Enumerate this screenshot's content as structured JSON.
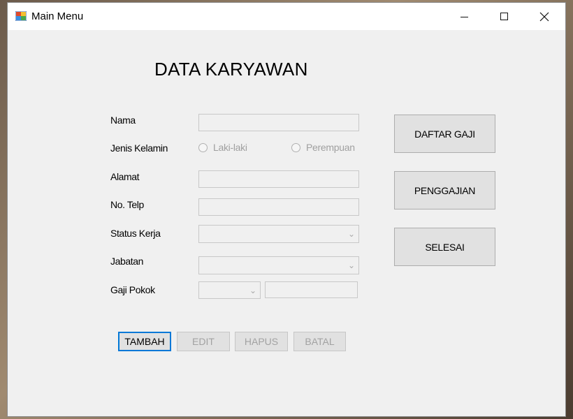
{
  "window": {
    "title": "Main Menu"
  },
  "heading": "DATA KARYAWAN",
  "form": {
    "nama_label": "Nama",
    "jenis_kelamin_label": "Jenis Kelamin",
    "radio_laki": "Laki-laki",
    "radio_perempuan": "Perempuan",
    "alamat_label": "Alamat",
    "no_telp_label": "No. Telp",
    "status_kerja_label": "Status Kerja",
    "jabatan_label": "Jabatan",
    "gaji_pokok_label": "Gaji Pokok",
    "nama_value": "",
    "alamat_value": "",
    "no_telp_value": "",
    "status_kerja_value": "",
    "jabatan_value": "",
    "gaji_pokok_combo_value": "",
    "gaji_pokok_value": ""
  },
  "side_buttons": {
    "daftar_gaji": "DAFTAR GAJI",
    "penggajian": "PENGGAJIAN",
    "selesai": "SELESAI"
  },
  "action_buttons": {
    "tambah": "TAMBAH",
    "edit": "EDIT",
    "hapus": "HAPUS",
    "batal": "BATAL"
  },
  "colors": {
    "focus_border": "#0078d7",
    "disabled_text": "#a2a2a2"
  }
}
